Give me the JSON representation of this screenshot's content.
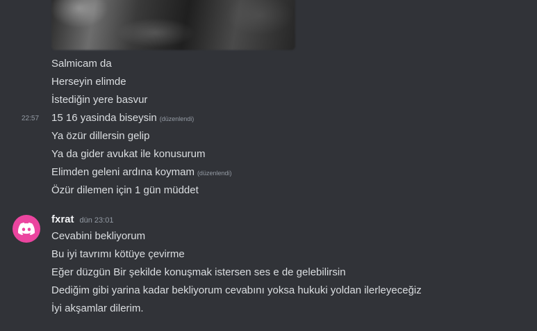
{
  "previous_messages": [
    {
      "text": "Salmicam da",
      "edited": false
    },
    {
      "text": "Herseyin elimde",
      "edited": false
    },
    {
      "text": "İstediğin yere basvur",
      "edited": false
    },
    {
      "text": "15 16 yasinda biseysin",
      "edited": true
    },
    {
      "text": "Ya özür dillersin gelip",
      "edited": false
    },
    {
      "text": "Ya da gider avukat ile konusurum",
      "edited": false
    },
    {
      "text": "Elimden geleni ardına koymam",
      "edited": true
    },
    {
      "text": "Özür dilemen için 1 gün müddet",
      "edited": false
    }
  ],
  "hover_timestamp": "22:57",
  "edited_label": "(düzenlendi)",
  "author": {
    "username": "fxrat",
    "timestamp": "dün 23:01",
    "avatar_color": "#eb459f",
    "avatar_icon": "discord-logo-icon"
  },
  "messages": [
    "Cevabini bekliyorum",
    "Bu iyi tavrımı kötüye çevirme",
    "Eğer düzgün Bir şekilde konuşmak istersen ses e de gelebilirsin",
    "Dediğim gibi yarina kadar bekliyorum cevabını yoksa hukuki yoldan ilerleyeceğiz",
    "İyi akşamlar dilerim."
  ]
}
